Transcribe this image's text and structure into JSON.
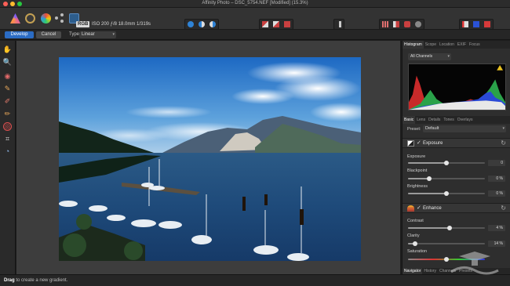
{
  "window": {
    "title": "Affinity Photo – DSC_5754.NEF [Modified] (15.3%)"
  },
  "toolbar": {
    "personas": [
      "photo-persona",
      "liquify-persona",
      "develop-persona",
      "tone-mapping-persona",
      "export-persona"
    ],
    "color_mode": "RGB",
    "exif": "ISO 200 ƒ/8 18.0mm 1/319s"
  },
  "context": {
    "develop_label": "Develop",
    "cancel_label": "Cancel",
    "type_label": "Type:",
    "type_value": "Linear"
  },
  "tools": [
    "hand-tool",
    "zoom-tool",
    "red-eye-tool",
    "retouch-brush-tool",
    "blemish-tool",
    "clone-tool",
    "overlay-gradient-tool",
    "crop-tool",
    "white-balance-tool"
  ],
  "panel": {
    "top_tabs": [
      "Histogram",
      "Scope",
      "Location",
      "EXIF",
      "Focus"
    ],
    "channels": "All Channels",
    "histogram": {
      "channels": [
        "red",
        "green",
        "blue",
        "white"
      ],
      "overexposure_warning": true
    },
    "mid_tabs": [
      "Basic",
      "Lens",
      "Details",
      "Tones",
      "Overlays"
    ],
    "preset_label": "Preset:",
    "preset_value": "Default",
    "exposure_section": "Exposure",
    "exposure": {
      "label": "Exposure",
      "value": "0"
    },
    "blackpoint": {
      "label": "Blackpoint",
      "value": "0 %"
    },
    "brightness": {
      "label": "Brightness",
      "value": "0 %"
    },
    "enhance_section": "Enhance",
    "contrast": {
      "label": "Contrast",
      "value": "4 %"
    },
    "clarity": {
      "label": "Clarity",
      "value": "14 %"
    },
    "saturation": {
      "label": "Saturation"
    },
    "bottom_tabs": [
      "Navigator",
      "History",
      "Channels",
      "Presets"
    ]
  },
  "status": {
    "action": "Drag",
    "text": "to create a new gradient."
  },
  "colors": {
    "accent": "#2b6cc4",
    "background": "#1d1d1d",
    "panel": "#2e2e2e"
  }
}
